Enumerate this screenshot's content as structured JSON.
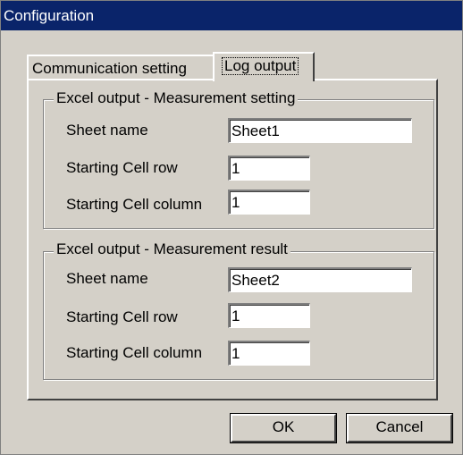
{
  "window": {
    "title": "Configuration"
  },
  "tabs": [
    {
      "label": "Communication setting",
      "active": false
    },
    {
      "label": "Log output",
      "active": true
    }
  ],
  "groups": [
    {
      "title": "Excel output - Measurement setting",
      "sheet_name_label": "Sheet name",
      "sheet_name_value": "Sheet1",
      "start_row_label": "Starting Cell row",
      "start_row_value": "1",
      "start_col_label": "Starting Cell column",
      "start_col_value": "1"
    },
    {
      "title": "Excel output - Measurement result",
      "sheet_name_label": "Sheet name",
      "sheet_name_value": "Sheet2",
      "start_row_label": "Starting Cell row",
      "start_row_value": "1",
      "start_col_label": "Starting Cell column",
      "start_col_value": "1"
    }
  ],
  "buttons": {
    "ok": "OK",
    "cancel": "Cancel"
  },
  "colors": {
    "titlebar": "#0a246a",
    "dialog": "#d4d0c8"
  }
}
